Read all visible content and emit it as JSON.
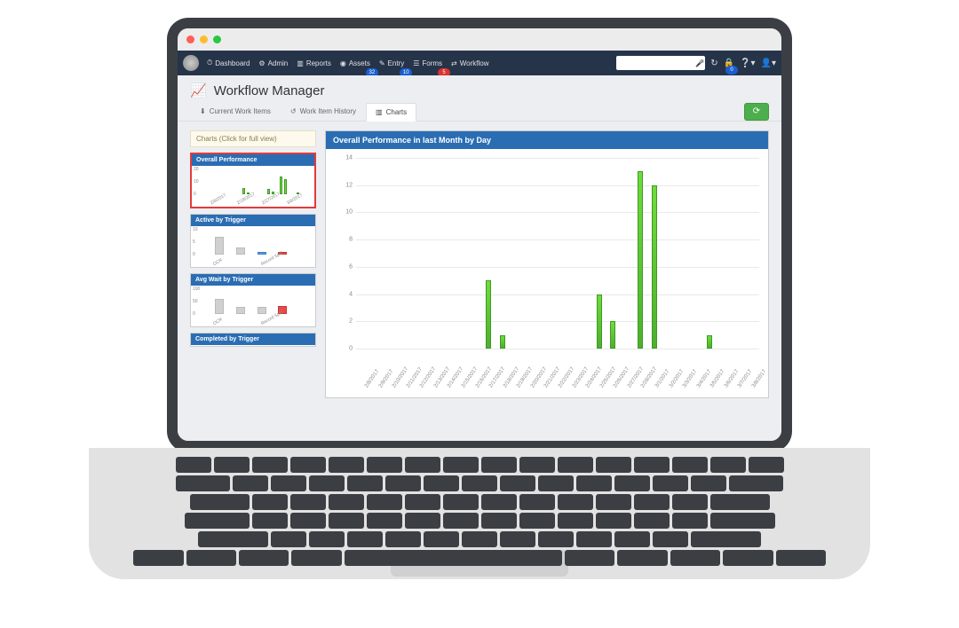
{
  "nav": {
    "items": [
      {
        "icon": "⏱",
        "label": "Dashboard"
      },
      {
        "icon": "⚙",
        "label": "Admin"
      },
      {
        "icon": "▥",
        "label": "Reports"
      },
      {
        "icon": "◉",
        "label": "Assets",
        "badge": "32",
        "badge_color": "blue"
      },
      {
        "icon": "✎",
        "label": "Entry",
        "badge": "10",
        "badge_color": "blue"
      },
      {
        "icon": "☰",
        "label": "Forms",
        "badge": "5",
        "badge_color": "red"
      },
      {
        "icon": "⇄",
        "label": "Workflow"
      }
    ],
    "right_badge": "0"
  },
  "page": {
    "title": "Workflow Manager"
  },
  "tabs": [
    {
      "icon": "⬇",
      "label": "Current Work Items"
    },
    {
      "icon": "↺",
      "label": "Work Item History"
    },
    {
      "icon": "▥",
      "label": "Charts"
    }
  ],
  "sidebar": {
    "header": "Charts (Click for full view)",
    "thumbs": [
      {
        "title": "Overall Performance"
      },
      {
        "title": "Active by Trigger"
      },
      {
        "title": "Avg Wait by Trigger"
      },
      {
        "title": "Completed by Trigger"
      }
    ],
    "thumb1_yticks": [
      "20",
      "10",
      "0"
    ],
    "thumb2": {
      "yticks": [
        "10",
        "5",
        "0"
      ],
      "xlabels": [
        "OCR",
        "Record Split"
      ]
    },
    "thumb3": {
      "yticks": [
        "100",
        "50",
        "0"
      ],
      "xlabels": [
        "OCR",
        "Record Split"
      ]
    }
  },
  "main_chart_title": "Overall Performance in last Month by Day",
  "chart_data": {
    "type": "bar",
    "title": "Overall Performance in last Month by Day",
    "xlabel": "",
    "ylabel": "",
    "ylim": [
      0,
      14
    ],
    "yticks": [
      0,
      2,
      4,
      6,
      8,
      10,
      12,
      14
    ],
    "categories": [
      "2/8/2017",
      "2/9/2017",
      "2/10/2017",
      "2/11/2017",
      "2/12/2017",
      "2/13/2017",
      "2/14/2017",
      "2/15/2017",
      "2/16/2017",
      "2/17/2017",
      "2/18/2017",
      "2/19/2017",
      "2/20/2017",
      "2/21/2017",
      "2/22/2017",
      "2/23/2017",
      "2/24/2017",
      "2/25/2017",
      "2/26/2017",
      "2/27/2017",
      "2/28/2017",
      "3/1/2017",
      "3/2/2017",
      "3/3/2017",
      "3/4/2017",
      "3/5/2017",
      "3/6/2017",
      "3/7/2017",
      "3/8/2017"
    ],
    "values": [
      0,
      0,
      0,
      0,
      0,
      0,
      0,
      0,
      0,
      5,
      1,
      0,
      0,
      0,
      0,
      0,
      0,
      4,
      2,
      0,
      13,
      12,
      0,
      0,
      0,
      1,
      0,
      0,
      0
    ]
  }
}
